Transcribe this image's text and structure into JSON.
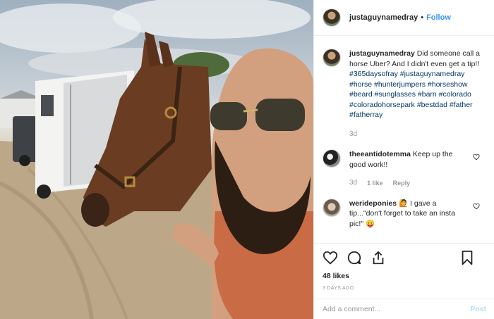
{
  "post": {
    "author": "justaguynamedray",
    "follow_label": "Follow",
    "dot": "•"
  },
  "caption": {
    "username": "justaguynamedray",
    "text": "Did someone call a horse Uber? And I didn't even get a tip!!",
    "hashtags": "#365daysofray #justaguynamedray #horse #hunterjumpers #horseshow #beard #sunglasses #barn #colorado #coloradohorsepark #bestdad #father #fatherray",
    "time": "3d"
  },
  "comments": [
    {
      "username": "theeantidotemma",
      "text": "Keep up the good work!!",
      "time": "3d",
      "likes": "1 like",
      "reply": "Reply"
    },
    {
      "username": "werideponies",
      "emoji": "🙋",
      "text": "I gave a tip...\"don't forget to take an insta pic!\" 😛"
    }
  ],
  "engagement": {
    "likes": "48 likes",
    "posted": "3 DAYS AGO"
  },
  "composer": {
    "placeholder": "Add a comment...",
    "post_label": "Post"
  },
  "icons": [
    "heart-icon",
    "comment-icon",
    "share-icon",
    "bookmark-icon"
  ]
}
